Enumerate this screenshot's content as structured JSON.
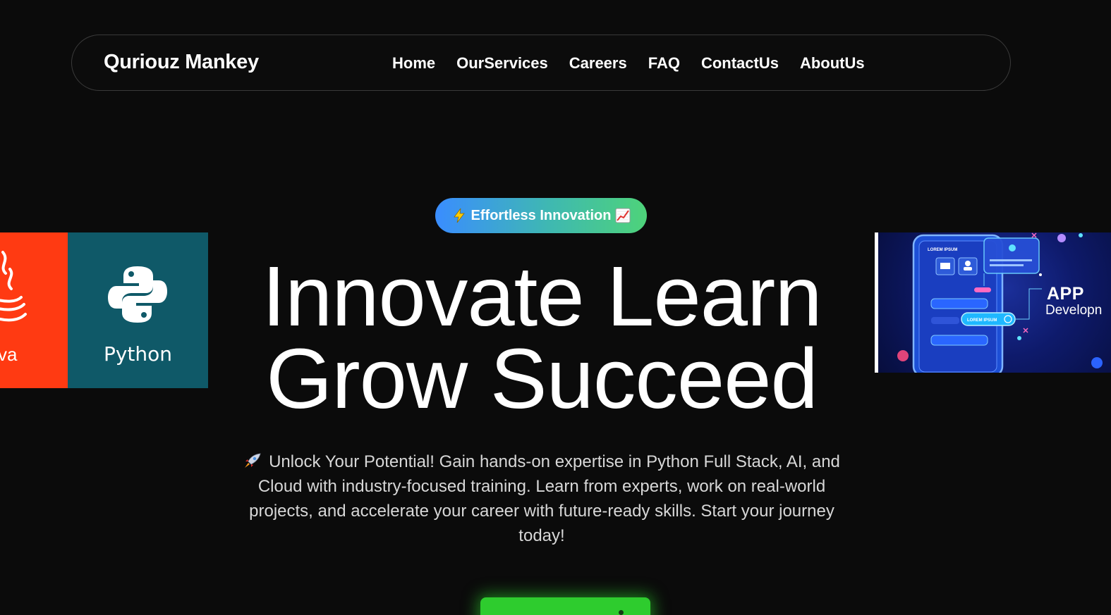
{
  "brand": {
    "name": "Quriouz Mankey"
  },
  "nav": {
    "links": [
      "Home",
      "OurServices",
      "Careers",
      "FAQ",
      "ContactUs",
      "AboutUs"
    ]
  },
  "hero": {
    "badge_text": "Effortless Innovation",
    "headline_line1": "Innovate Learn",
    "headline_line2": "Grow Succeed",
    "description": "Unlock Your Potential! Gain hands-on expertise in Python Full Stack, AI, and Cloud with industry-focused training. Learn from experts, work on real-world projects, and accelerate your career with future-ready skills. Start your journey today!"
  },
  "cards": {
    "java_label": "va",
    "python_label": "Python",
    "app_title": "APP",
    "app_subtitle": "Developn",
    "phone_screen_label": "LOREM IPSUM",
    "phone_button_label": "LOREM IPSUM"
  },
  "colors": {
    "background": "#0b0b0b",
    "badge_gradient_start": "#3a8dff",
    "badge_gradient_end": "#4ed37a",
    "cta_green": "#2ecc2e",
    "java_red": "#ff3a12",
    "python_teal": "#0f5968",
    "app_blue": "#0e1a6b"
  },
  "icons": {
    "badge_left": "lightning-icon",
    "badge_right": "chart-increasing-icon",
    "description_prefix": "rocket-icon",
    "java_logo": "java-cup-icon",
    "python_logo": "python-logo-icon"
  }
}
